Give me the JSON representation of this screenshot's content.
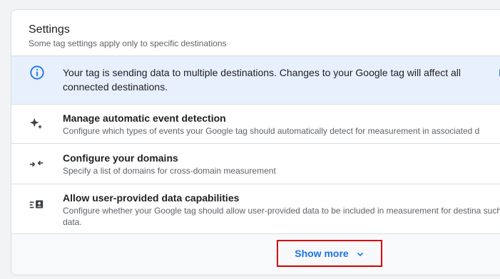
{
  "settings": {
    "title": "Settings",
    "subtitle": "Some tag settings apply only to specific destinations"
  },
  "banner": {
    "icon": "info-icon",
    "text": "Your tag is sending data to multiple destinations. Changes to your Google tag will affect all connected destinations.",
    "cutoff_text": "E"
  },
  "items": [
    {
      "icon": "sparkle-icon",
      "title": "Manage automatic event detection",
      "description": "Configure which types of events your Google tag should automatically detect for measurement in associated d"
    },
    {
      "icon": "arrows-merge-icon",
      "title": "Configure your domains",
      "description": "Specify a list of domains for cross-domain measurement"
    },
    {
      "icon": "user-data-icon",
      "title": "Allow user-provided data capabilities",
      "description": "Configure whether your Google tag should allow user-provided data to be included in measurement for destina such data."
    }
  ],
  "footer": {
    "show_more_label": "Show more",
    "show_more_icon": "chevron-down-icon"
  },
  "colors": {
    "accent": "#1a73e8",
    "banner_bg": "#e8f0fe",
    "highlight_border": "#d50000"
  }
}
